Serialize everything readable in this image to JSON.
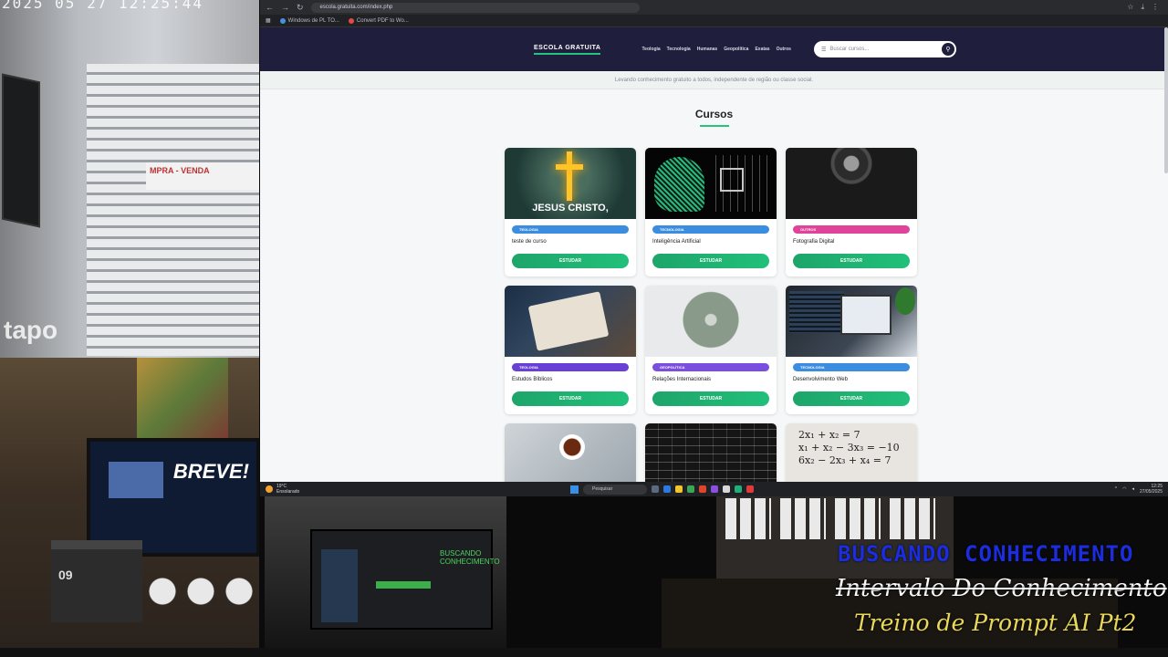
{
  "camera_top": {
    "timestamp": "2025  05  27  12:25:44",
    "brand": "tapo",
    "sign_text": "MPRA - VENDA"
  },
  "camera_bottom": {
    "monitor_text": "BREVE!",
    "calendar_number": "09"
  },
  "stream_overlay": {
    "line1": "BUSCANDO CONHECIMENTO",
    "line2": "Intervalo Do Conhecimento",
    "line3": "Treino de Prompt AI Pt2"
  },
  "browser": {
    "address": "escola.gratuita.com/index.php",
    "bookmarks": [
      {
        "label": "Windows de PL TO..."
      },
      {
        "label": "Convert PDF to Wo..."
      }
    ],
    "site": {
      "logo": "ESCOLA GRATUITA",
      "nav": [
        "Teologia",
        "Tecnologia",
        "Humanas",
        "Geopolítica",
        "Exatas",
        "Outros"
      ],
      "search_placeholder": "Buscar cursos...",
      "tagline": "Levando conhecimento gratuito a todos, independente de região ou classe social.",
      "section_title": "Cursos",
      "study_label": "ESTUDAR",
      "courses": [
        {
          "category": "TEOLOGIA",
          "title": "teste de curso",
          "badge_color": "#3b8de0"
        },
        {
          "category": "TECNOLOGIA",
          "title": "Inteligência Artificial",
          "badge_color": "#3b8de0"
        },
        {
          "category": "OUTROS",
          "title": "Fotografia Digital",
          "badge_color": "#e0439a"
        },
        {
          "category": "TEOLOGIA",
          "title": "Estudos Bíblicos",
          "badge_color": "#6a3fd6"
        },
        {
          "category": "GEOPOLÍTICA",
          "title": "Relações Internacionais",
          "badge_color": "#7a4fe0"
        },
        {
          "category": "TECNOLOGIA",
          "title": "Desenvolvimento Web",
          "badge_color": "#3b8de0"
        },
        {
          "category": "",
          "title": "",
          "badge_color": "#3b8de0"
        },
        {
          "category": "",
          "title": "",
          "badge_color": "#3b8de0"
        },
        {
          "category": "",
          "title": "",
          "badge_color": "#3b8de0"
        }
      ]
    }
  },
  "taskbar": {
    "weather_temp": "19°C",
    "weather_desc": "Ensolarado",
    "search_label": "Pesquisar",
    "time": "12:25",
    "date": "27/05/2025"
  },
  "colors": {
    "header_bg": "#1f1f3d",
    "accent_green": "#26c281"
  }
}
